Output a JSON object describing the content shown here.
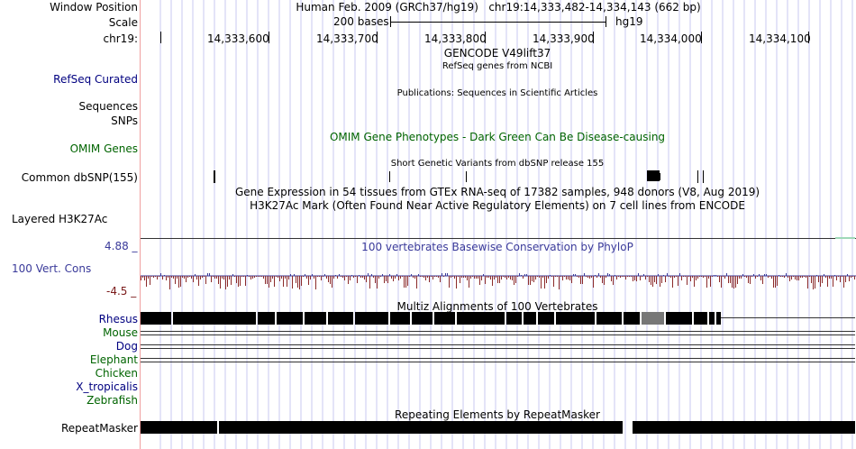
{
  "header": {
    "window_position_label": "Window Position",
    "window_position_value": "Human Feb. 2009 (GRCh37/hg19)   chr19:14,333,482-14,334,143 (662 bp)",
    "scale_label": "Scale",
    "scale_value": "200 bases",
    "scale_assembly": "hg19",
    "chrom_label": "chr19:",
    "ticks": [
      "14,333,600",
      "14,333,700",
      "14,333,800",
      "14,333,900",
      "14,334,000",
      "14,334,100"
    ]
  },
  "tracks": {
    "gencode_title": "GENCODE V49lift37",
    "refseq_title": "RefSeq genes from NCBI",
    "refseq_label": "RefSeq Curated",
    "publications_title": "Publications: Sequences in Scientific Articles",
    "sequences_label": "Sequences",
    "snps_label": "SNPs",
    "omim_title": "OMIM Gene Phenotypes - Dark Green Can Be Disease-causing",
    "omim_label": "OMIM Genes",
    "dbsnp_title": "Short Genetic Variants from dbSNP release 155",
    "dbsnp_label": "Common dbSNP(155)",
    "gtex_title": "Gene Expression in 54 tissues from GTEx RNA-seq of 17382 samples, 948 donors (V8, Aug 2019)",
    "h3k27ac_title": "H3K27Ac Mark (Often Found Near Active Regulatory Elements) on 7 cell lines from ENCODE",
    "h3k27ac_label": "Layered H3K27Ac",
    "cons_max": "4.88 _",
    "cons_title": "100 vertebrates Basewise Conservation by PhyloP",
    "cons_label": "100 Vert. Cons",
    "cons_min": "-4.5 _",
    "multiz_title": "Multiz Alignments of 100 Vertebrates",
    "species": [
      "Rhesus",
      "Mouse",
      "Dog",
      "Elephant",
      "Chicken",
      "X_tropicalis",
      "Zebrafish"
    ],
    "repeat_title": "Repeating Elements by RepeatMasker",
    "repeat_label": "RepeatMasker"
  },
  "colors": {
    "navy": "#000080",
    "green": "#006400",
    "blue_title": "#3a3a9a",
    "maroon": "#7a1a1a",
    "grid": "#c8c8f0",
    "divider": "#f0a0a0"
  }
}
